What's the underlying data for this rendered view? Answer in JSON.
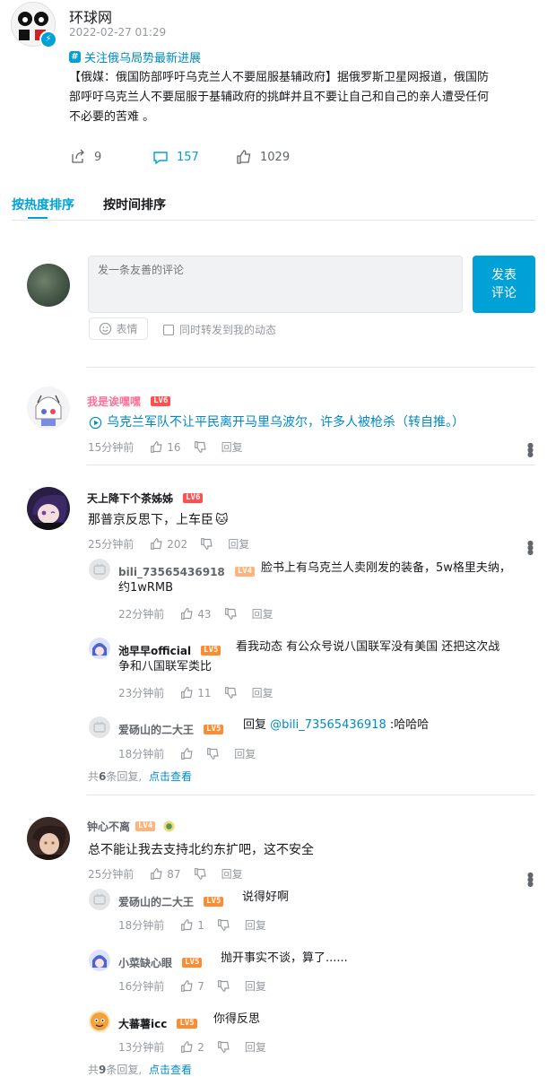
{
  "post": {
    "author": "环球网",
    "time": "2022-02-27 01:29",
    "topic": "关注俄乌局势最新进展",
    "body": "【俄媒：俄国防部呼吁乌克兰人不要屈服基辅政府】据俄罗斯卫星网报道，俄国防部呼吁乌克兰人不要屈服于基辅政府的挑衅并且不要让自己和自己的亲人遭受任何不必要的苦难 。",
    "body_lines": [
      "【俄媒：俄国防部呼吁乌克兰人不要屈服基辅政府】据俄罗斯卫星网报道，俄国防",
      "部呼吁乌克兰人不要屈服于基辅政府的挑衅并且不要让自己和自己的亲人遭受任何",
      "不必要的苦难 。"
    ],
    "shares": "9",
    "comments": "157",
    "likes": "1029"
  },
  "sort_tabs": {
    "hot": "按热度排序",
    "time": "按时间排序"
  },
  "composer": {
    "placeholder": "发一条友善的评论",
    "submit_line1": "发表",
    "submit_line2": "评论",
    "emoji_label": "表情",
    "repost_label": "同时转发到我的动态"
  },
  "labels": {
    "reply": "回复",
    "view_more": "点击查看"
  },
  "comments": [
    {
      "user": "我是诶嘿嘿",
      "level": "LV6",
      "text": "乌克兰军队不让平民离开马里乌波尔，许多人被枪杀（转自推。）",
      "time": "15分钟前",
      "likes": "16"
    },
    {
      "user": "天上降下个茶姊姊",
      "level": "LV6",
      "text": "那普京反思下，上车臣",
      "emoji": "🐱",
      "time": "25分钟前",
      "likes": "202",
      "replies": [
        {
          "user": "bili_73565436918",
          "level": "LV4",
          "text1": "脸书上有乌克兰人卖刚发的装备，5w格里夫纳，",
          "text2": "约1wRMB",
          "time": "22分钟前",
          "likes": "43"
        },
        {
          "user": "池早早official",
          "level": "LV5",
          "text1": "看我动态 有公众号说八国联军没有美国  还把这次战",
          "text2": "争和八国联军类比",
          "time": "23分钟前",
          "likes": "11"
        },
        {
          "user": "爱砀山的二大王",
          "level": "LV5",
          "prefix": "回复 ",
          "mention": "@bili_73565436918",
          "suffix": " :哈哈哈",
          "time": "18分钟前",
          "likes": ""
        }
      ],
      "reply_count_prefix": "共",
      "reply_count": "6",
      "reply_count_suffix": "条回复,"
    },
    {
      "user": "钟心不离",
      "level": "LV4",
      "text": "总不能让我去支持北约东扩吧，这不安全",
      "time": "25分钟前",
      "likes": "87",
      "replies": [
        {
          "user": "爱砀山的二大王",
          "level": "LV5",
          "text": "说得好啊",
          "time": "18分钟前",
          "likes": "1"
        },
        {
          "user": "小菜缺心眼",
          "level": "LV5",
          "text": "抛开事实不谈，算了......",
          "time": "16分钟前",
          "likes": "7"
        },
        {
          "user": "大蕃薯icc",
          "level": "LV5",
          "text": "你得反思",
          "time": "13分钟前",
          "likes": "2"
        }
      ],
      "reply_count_prefix": "共",
      "reply_count": "9",
      "reply_count_suffix": "条回复,"
    }
  ],
  "colors": {
    "accent": "#00a1d6",
    "link": "#008ac5",
    "lv6": "#ff4f4f",
    "lv5": "#ff8b30",
    "lv4": "#ffb37c",
    "pink_name": "#fb7299"
  }
}
